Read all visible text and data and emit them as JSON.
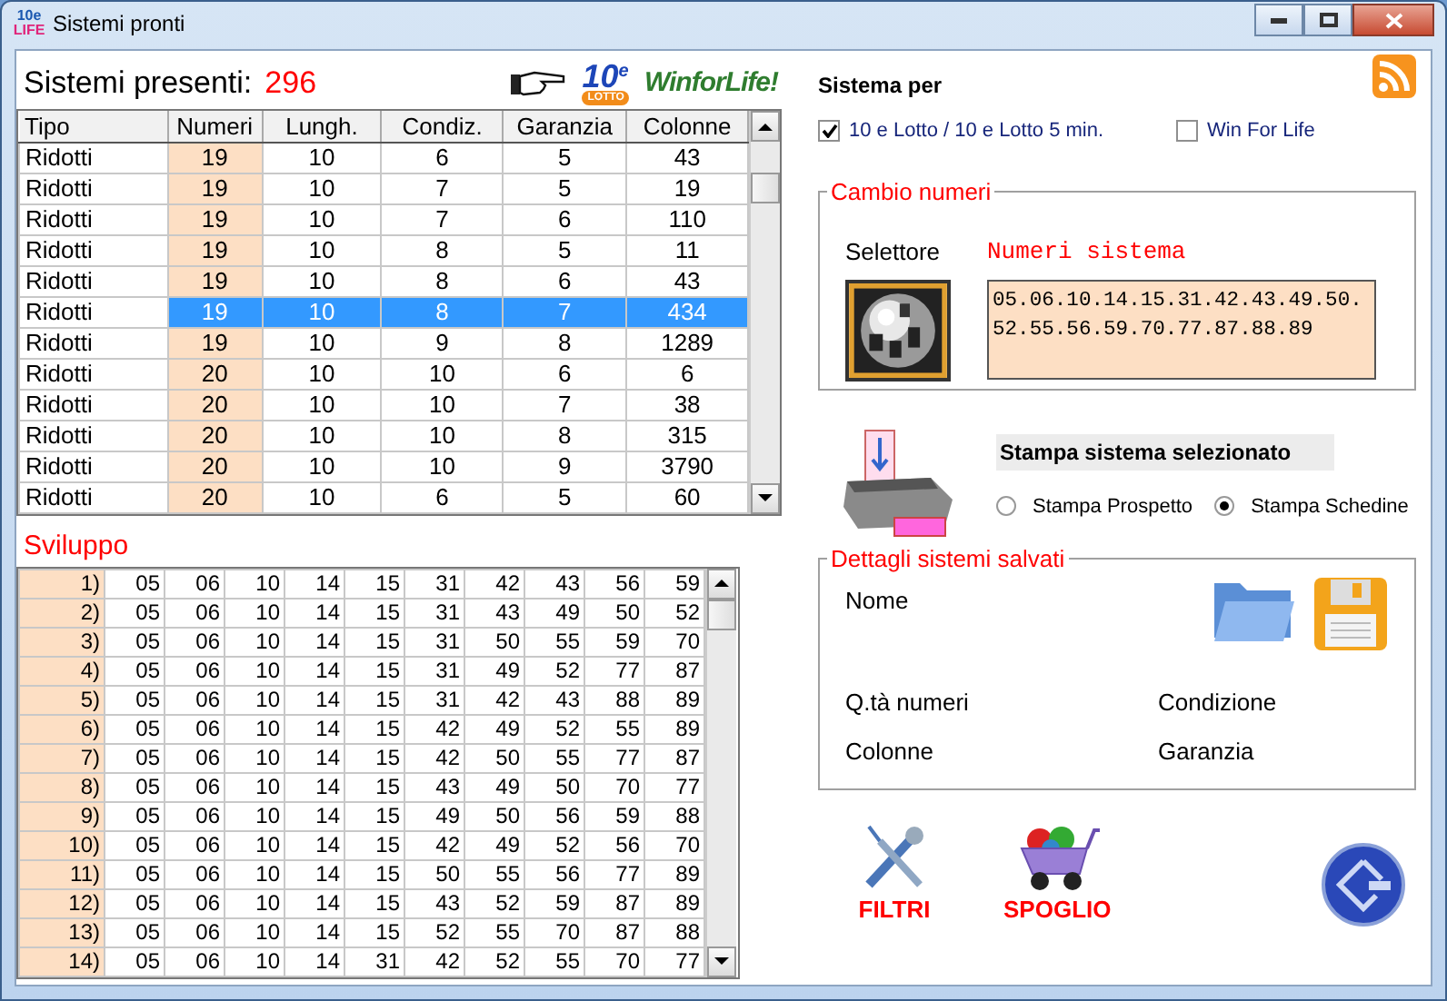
{
  "window": {
    "title": "Sistemi pronti",
    "icon_text": [
      "10e",
      "LIFE"
    ]
  },
  "systems_count": {
    "label": "Sistemi presenti:",
    "value": "296"
  },
  "logos": [
    {
      "kind": "lotto",
      "main": "10",
      "sup": "e",
      "sub": "LOTTO"
    },
    {
      "kind": "wfl",
      "text": "WinforLife!"
    }
  ],
  "systems_table": {
    "columns": [
      "Tipo",
      "Numeri",
      "Lungh.",
      "Condiz.",
      "Garanzia",
      "Colonne"
    ],
    "rows": [
      {
        "cells": [
          "Ridotti",
          "19",
          "10",
          "6",
          "5",
          "43"
        ],
        "selected": false
      },
      {
        "cells": [
          "Ridotti",
          "19",
          "10",
          "7",
          "5",
          "19"
        ],
        "selected": false
      },
      {
        "cells": [
          "Ridotti",
          "19",
          "10",
          "7",
          "6",
          "110"
        ],
        "selected": false
      },
      {
        "cells": [
          "Ridotti",
          "19",
          "10",
          "8",
          "5",
          "11"
        ],
        "selected": false
      },
      {
        "cells": [
          "Ridotti",
          "19",
          "10",
          "8",
          "6",
          "43"
        ],
        "selected": false
      },
      {
        "cells": [
          "Ridotti",
          "19",
          "10",
          "8",
          "7",
          "434"
        ],
        "selected": true
      },
      {
        "cells": [
          "Ridotti",
          "19",
          "10",
          "9",
          "8",
          "1289"
        ],
        "selected": false
      },
      {
        "cells": [
          "Ridotti",
          "20",
          "10",
          "10",
          "6",
          "6"
        ],
        "selected": false
      },
      {
        "cells": [
          "Ridotti",
          "20",
          "10",
          "10",
          "7",
          "38"
        ],
        "selected": false
      },
      {
        "cells": [
          "Ridotti",
          "20",
          "10",
          "10",
          "8",
          "315"
        ],
        "selected": false
      },
      {
        "cells": [
          "Ridotti",
          "20",
          "10",
          "10",
          "9",
          "3790"
        ],
        "selected": false
      },
      {
        "cells": [
          "Ridotti",
          "20",
          "10",
          "6",
          "5",
          "60"
        ],
        "selected": false
      }
    ]
  },
  "sviluppo": {
    "title": "Sviluppo",
    "rows": [
      {
        "index": "1)",
        "numbers": [
          "05",
          "06",
          "10",
          "14",
          "15",
          "31",
          "42",
          "43",
          "56",
          "59"
        ]
      },
      {
        "index": "2)",
        "numbers": [
          "05",
          "06",
          "10",
          "14",
          "15",
          "31",
          "43",
          "49",
          "50",
          "52"
        ]
      },
      {
        "index": "3)",
        "numbers": [
          "05",
          "06",
          "10",
          "14",
          "15",
          "31",
          "50",
          "55",
          "59",
          "70"
        ]
      },
      {
        "index": "4)",
        "numbers": [
          "05",
          "06",
          "10",
          "14",
          "15",
          "31",
          "49",
          "52",
          "77",
          "87"
        ]
      },
      {
        "index": "5)",
        "numbers": [
          "05",
          "06",
          "10",
          "14",
          "15",
          "31",
          "42",
          "43",
          "88",
          "89"
        ]
      },
      {
        "index": "6)",
        "numbers": [
          "05",
          "06",
          "10",
          "14",
          "15",
          "42",
          "49",
          "52",
          "55",
          "89"
        ]
      },
      {
        "index": "7)",
        "numbers": [
          "05",
          "06",
          "10",
          "14",
          "15",
          "42",
          "50",
          "55",
          "77",
          "87"
        ]
      },
      {
        "index": "8)",
        "numbers": [
          "05",
          "06",
          "10",
          "14",
          "15",
          "43",
          "49",
          "50",
          "70",
          "77"
        ]
      },
      {
        "index": "9)",
        "numbers": [
          "05",
          "06",
          "10",
          "14",
          "15",
          "49",
          "50",
          "56",
          "59",
          "88"
        ]
      },
      {
        "index": "10)",
        "numbers": [
          "05",
          "06",
          "10",
          "14",
          "15",
          "42",
          "49",
          "52",
          "56",
          "70"
        ]
      },
      {
        "index": "11)",
        "numbers": [
          "05",
          "06",
          "10",
          "14",
          "15",
          "50",
          "55",
          "56",
          "77",
          "89"
        ]
      },
      {
        "index": "12)",
        "numbers": [
          "05",
          "06",
          "10",
          "14",
          "15",
          "43",
          "52",
          "59",
          "87",
          "89"
        ]
      },
      {
        "index": "13)",
        "numbers": [
          "05",
          "06",
          "10",
          "14",
          "15",
          "52",
          "55",
          "70",
          "87",
          "88"
        ]
      },
      {
        "index": "14)",
        "numbers": [
          "05",
          "06",
          "10",
          "14",
          "31",
          "42",
          "52",
          "55",
          "70",
          "77"
        ]
      }
    ]
  },
  "sistema_per": {
    "title": "Sistema per",
    "options": [
      {
        "label": "10 e Lotto / 10 e Lotto 5 min.",
        "checked": true
      },
      {
        "label": "Win For Life",
        "checked": false
      }
    ]
  },
  "cambio_numeri": {
    "title": "Cambio numeri",
    "selector_label": "Selettore",
    "numbers_label": "Numeri sistema",
    "numbers_value": "05.06.10.14.15.31.42.43.49.50.52.55.56.59.70.77.87.88.89"
  },
  "stampa": {
    "title": "Stampa sistema selezionato",
    "options": [
      {
        "label": "Stampa Prospetto",
        "selected": false
      },
      {
        "label": "Stampa Schedine",
        "selected": true
      }
    ]
  },
  "dettagli": {
    "title": "Dettagli sistemi salvati",
    "name_label": "Nome",
    "fields": [
      "Q.tà numeri",
      "Condizione",
      "Colonne",
      "Garanzia"
    ]
  },
  "actions": [
    {
      "kind": "filters",
      "label": "FILTRI"
    },
    {
      "kind": "cart",
      "label": "SPOGLIO"
    }
  ]
}
